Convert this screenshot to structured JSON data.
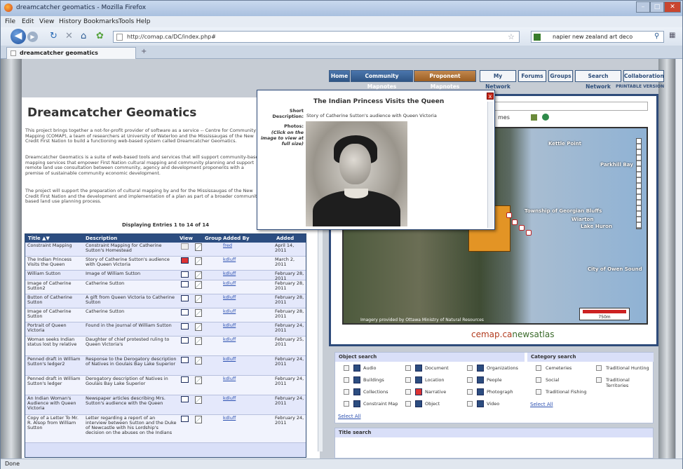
{
  "browser": {
    "window_title": "dreamcatcher geomatics - Mozilla Firefox",
    "menu": [
      "File",
      "Edit",
      "View",
      "History",
      "Bookmarks",
      "Tools",
      "Help"
    ],
    "url": "http://comap.ca/DC/index.php#",
    "search_value": "napier new zealand art deco",
    "tab_label": "dreamcatcher geomatics",
    "new_tab": "+",
    "status": "Done"
  },
  "site_nav": {
    "items": [
      "Home",
      "Community Mapnotes",
      "Proponent Mapnotes",
      "My Network",
      "Forums",
      "Groups",
      "Search Network",
      "Collaboration"
    ],
    "printable": "PRINTABLE VERSION"
  },
  "intro": {
    "title": "Dreamcatcher Geomatics",
    "p1": "This project brings together a not-for-profit provider of software as a service -- Centre for Community Mapping (COMAP), a team of researchers at University of Waterloo and the Mississaugas of the New Credit First Nation to build a functioning web-based system called Dreamcatcher Geomatics.",
    "p2": "Dreamcatcher Geomatics is a suite of web-based tools and services that will support community-based mapping services that empower First Nation cultural mapping and community planning and support remote land use consultation between community, agency and development proponents with a premise of sustainable community economic development.",
    "p3": "The project will support the preparation of cultural mapping by and for the Mississaugas of the New Credit First Nation and the development and implementation of a plan as part of a broader community-based land use planning process."
  },
  "table": {
    "displaying": "Displaying Entries 1 to 14 of 14",
    "headers": [
      "Title ▲▼",
      "Description",
      "View",
      "Group",
      "Added By",
      "Added"
    ],
    "rows": [
      {
        "title": "Constraint Mapping",
        "desc": "Constraint Mapping for Catherine Sutton's Homestead",
        "by": "fred",
        "added": "April 14, 2011"
      },
      {
        "title": "The Indian Princess Visits the Queen",
        "desc": "Story of Catherine Sutton's audience with Queen Victoria",
        "by": "kdluff",
        "added": "March 2, 2011"
      },
      {
        "title": "William Sutton",
        "desc": "Image of William Sutton",
        "by": "kdluff",
        "added": "February 28, 2011"
      },
      {
        "title": "Image of Catherine Sutton2",
        "desc": "Catherine Sutton",
        "by": "kdluff",
        "added": "February 28, 2011"
      },
      {
        "title": "Button of Catherine Sutton",
        "desc": "A gift from Queen Victoria to Catherine Sutton",
        "by": "kdluff",
        "added": "February 28, 2011"
      },
      {
        "title": "Image of Catherine Sutton",
        "desc": "Catherine Sutton",
        "by": "kdluff",
        "added": "February 28, 2011"
      },
      {
        "title": "Portrait of Queen Victoria",
        "desc": "Found in the journal of William Sutton",
        "by": "kdluff",
        "added": "February 24, 2011"
      },
      {
        "title": "Woman seeks Indian status lost by relative",
        "desc": "Daughter of chief protested ruling to Queen Victoria's",
        "by": "kdluff",
        "added": "February 25, 2011"
      },
      {
        "title": "Penned draft in William Sutton's ledger2",
        "desc": "Response to the Derogatory description of Natives in Goulais Bay Lake Superior",
        "by": "kdluff",
        "added": "February 24, 2011"
      },
      {
        "title": "Penned draft in William Sutton's ledger",
        "desc": "Derogatory description of Natives in Goulais Bay Lake Superior",
        "by": "kdluff",
        "added": "February 24, 2011"
      },
      {
        "title": "An Indian Woman's Audience with Queen Victoria",
        "desc": "Newspaper articles describing Mrs. Sutton's audience with the Queen",
        "by": "kdluff",
        "added": "February 24, 2011"
      },
      {
        "title": "Copy of a Letter To Mr. R. Alsop from William Sutton",
        "desc": "Letter regarding a report of an interview between Sutton and the Duke of Newcastle with his Lordship's decision on the abuses on the Indians",
        "by": "kdluff",
        "added": "February 24, 2011"
      }
    ]
  },
  "popup": {
    "title": "The Indian Princess Visits the Queen",
    "short_label": "Short Description:",
    "short_value": "Story of Catherine Sutton's audience with Queen Victoria",
    "photos_label": "Photos:",
    "photos_hint": "(Click on the image to view at full size)",
    "close": "x"
  },
  "map": {
    "names_frag": "mes",
    "labels": [
      "Kettle Point",
      "Parkhill Bay",
      "Township of Georgian Bluffs",
      "Wiarton",
      "Lake Huron",
      "City of Owen Sound"
    ],
    "imagery": "Imagery provided by Ottawa Ministry of Natural Resources",
    "scale": "750m",
    "brand_a": "cemap.ca",
    "brand_b": "newsatlas"
  },
  "object_search": {
    "title": "Object search",
    "col1": [
      "Audio",
      "Buildings",
      "Collections",
      "Constraint Map"
    ],
    "col2": [
      "Document",
      "Location",
      "Narrative",
      "Object"
    ],
    "col3": [
      "Organizations",
      "People",
      "Photograph",
      "Video"
    ],
    "select_all": "Select All",
    "cat_title": "Category search",
    "cat1": [
      "Cemeteries",
      "Social",
      "Traditional Fishing"
    ],
    "cat2": [
      "Traditional Hunting",
      "Traditional Territories"
    ],
    "cat_select_all": "Select All"
  },
  "title_search": {
    "title": "Title search"
  }
}
